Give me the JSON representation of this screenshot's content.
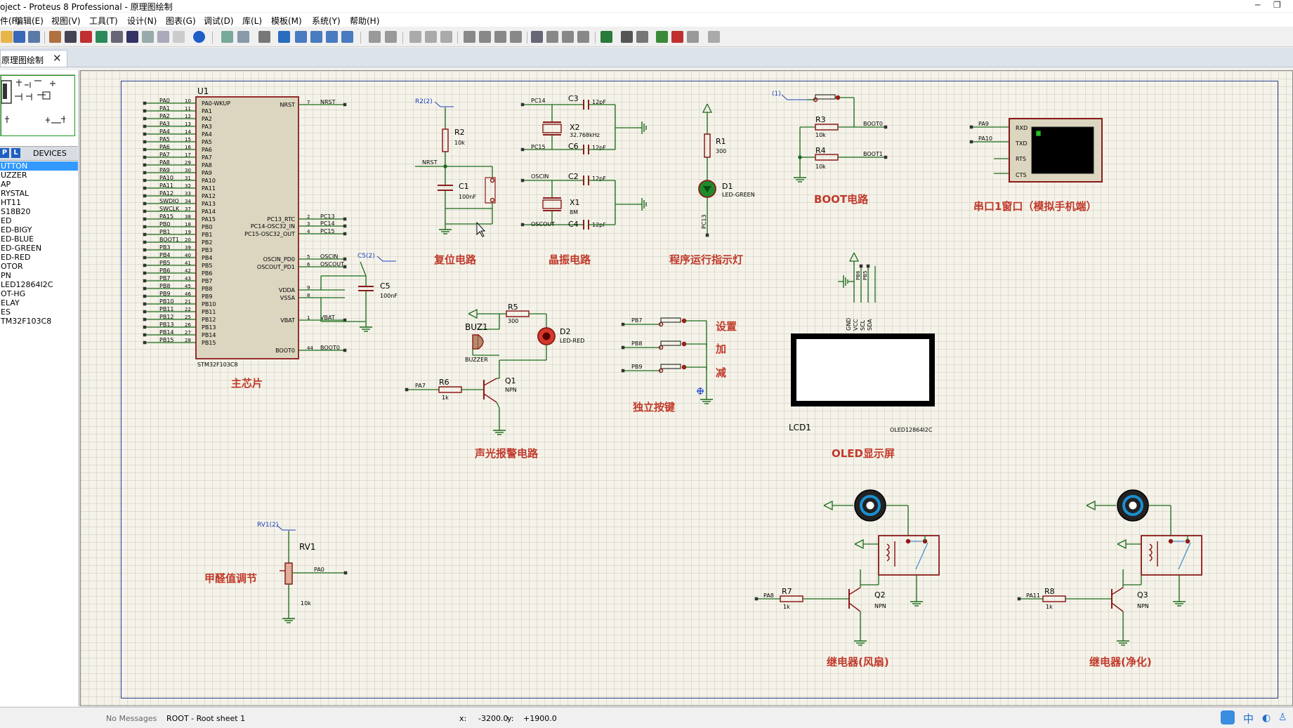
{
  "window": {
    "title": "oject - Proteus 8 Professional - 原理图绘制",
    "minimize": "─",
    "restore": "❐"
  },
  "menu": [
    "件(F)",
    "编辑(E)",
    "视图(V)",
    "工具(T)",
    "设计(N)",
    "图表(G)",
    "调试(D)",
    "库(L)",
    "模板(M)",
    "系统(Y)",
    "帮助(H)"
  ],
  "tab": {
    "label": "原理图绘制",
    "close": "✕"
  },
  "panel": {
    "p_button": "P",
    "l_button": "L",
    "header": "DEVICES",
    "devices": [
      "UTTON",
      "UZZER",
      "AP",
      "RYSTAL",
      "HT11",
      "S18B20",
      "ED",
      "ED-BIGY",
      "ED-BLUE",
      "ED-GREEN",
      "ED-RED",
      "OTOR",
      "PN",
      "LED12864I2C",
      "OT-HG",
      "ELAY",
      "ES",
      "TM32F103C8"
    ],
    "selected_index": 0
  },
  "schematic": {
    "labels": {
      "main_chip": "主芯片",
      "reset": "复位电路",
      "crystal": "晶振电路",
      "run_led": "程序运行指示灯",
      "boot": "BOOT电路",
      "uart": "串口1窗口（模拟手机端）",
      "alarm": "声光报警电路",
      "keys": "独立按键",
      "oled": "OLED显示屏",
      "formaldehyde": "甲醛值调节",
      "relay_fan": "继电器(风扇)",
      "relay_purify": "继电器(净化)",
      "set": "设置",
      "add": "加",
      "sub": "减"
    },
    "u1": {
      "ref": "U1",
      "part": "STM32F103C8",
      "left_pins": [
        {
          "net": "PA0",
          "num": "10",
          "name": "PA0-WKUP"
        },
        {
          "net": "PA1",
          "num": "11",
          "name": "PA1"
        },
        {
          "net": "PA2",
          "num": "12",
          "name": "PA2"
        },
        {
          "net": "PA3",
          "num": "13",
          "name": "PA3"
        },
        {
          "net": "PA4",
          "num": "14",
          "name": "PA4"
        },
        {
          "net": "PA5",
          "num": "15",
          "name": "PA5"
        },
        {
          "net": "PA6",
          "num": "16",
          "name": "PA6"
        },
        {
          "net": "PA7",
          "num": "17",
          "name": "PA7"
        },
        {
          "net": "PA8",
          "num": "29",
          "name": "PA8"
        },
        {
          "net": "PA9",
          "num": "30",
          "name": "PA9"
        },
        {
          "net": "PA10",
          "num": "31",
          "name": "PA10"
        },
        {
          "net": "PA11",
          "num": "32",
          "name": "PA11"
        },
        {
          "net": "PA12",
          "num": "33",
          "name": "PA12"
        },
        {
          "net": "SWDIO",
          "num": "34",
          "name": "PA13"
        },
        {
          "net": "SWCLK",
          "num": "37",
          "name": "PA14"
        },
        {
          "net": "PA15",
          "num": "38",
          "name": "PA15"
        },
        {
          "net": "PB0",
          "num": "18",
          "name": "PB0"
        },
        {
          "net": "PB1",
          "num": "19",
          "name": "PB1"
        },
        {
          "net": "BOOT1",
          "num": "20",
          "name": "PB2"
        },
        {
          "net": "PB3",
          "num": "39",
          "name": "PB3"
        },
        {
          "net": "PB4",
          "num": "40",
          "name": "PB4"
        },
        {
          "net": "PB5",
          "num": "41",
          "name": "PB5"
        },
        {
          "net": "PB6",
          "num": "42",
          "name": "PB6"
        },
        {
          "net": "PB7",
          "num": "43",
          "name": "PB7"
        },
        {
          "net": "PB8",
          "num": "45",
          "name": "PB8"
        },
        {
          "net": "PB9",
          "num": "46",
          "name": "PB9"
        },
        {
          "net": "PB10",
          "num": "21",
          "name": "PB10"
        },
        {
          "net": "PB11",
          "num": "22",
          "name": "PB11"
        },
        {
          "net": "PB12",
          "num": "25",
          "name": "PB12"
        },
        {
          "net": "PB13",
          "num": "26",
          "name": "PB13"
        },
        {
          "net": "PB14",
          "num": "27",
          "name": "PB14"
        },
        {
          "net": "PB15",
          "num": "28",
          "name": "PB15"
        }
      ],
      "right_pins": [
        {
          "name": "NRST",
          "num": "7",
          "net": "NRST"
        },
        {
          "name": "PC13_RTC",
          "num": "2",
          "net": "PC13"
        },
        {
          "name": "PC14-OSC32_IN",
          "num": "3",
          "net": "PC14"
        },
        {
          "name": "PC15-OSC32_OUT",
          "num": "4",
          "net": "PC15"
        },
        {
          "name": "OSCIN_PD0",
          "num": "5",
          "net": "OSCIN"
        },
        {
          "name": "OSCOUT_PD1",
          "num": "6",
          "net": "OSCOUT"
        },
        {
          "name": "VDDA",
          "num": "9",
          "net": ""
        },
        {
          "name": "VSSA",
          "num": "8",
          "net": ""
        },
        {
          "name": "VBAT",
          "num": "1",
          "net": "VBAT"
        },
        {
          "name": "BOOT0",
          "num": "44",
          "net": "BOOT0"
        }
      ]
    },
    "parts": {
      "r2": "R2",
      "r2v": "10k",
      "r2probe": "R2(2)",
      "c1": "C1",
      "c1v": "100nF",
      "nrst": "NRST",
      "c3": "C3",
      "c3v": "12pF",
      "x2": "X2",
      "x2v": "32.768kHz",
      "c6": "C6",
      "c6v": "12pF",
      "pc14": "PC14",
      "pc15": "PC15",
      "c2": "C2",
      "c2v": "12pF",
      "x1": "X1",
      "x1v": "8M",
      "c4": "C4",
      "c4v": "12pF",
      "oscin": "OSCIN",
      "oscout": "OSCOUT",
      "r1": "R1",
      "r1v": "300",
      "d1": "D1",
      "d1v": "LED-GREEN",
      "pc13": "PC13",
      "probe1": "(1)",
      "r3": "R3",
      "r3v": "10k",
      "r4": "R4",
      "r4v": "10k",
      "boot0": "BOOT0",
      "boot1": "BOOT1",
      "pa9": "PA9",
      "pa10": "PA10",
      "rxd": "RXD",
      "txd": "TXD",
      "rts": "RTS",
      "cts": "CTS",
      "c5": "C5",
      "c5v": "100nF",
      "c5probe": "C5(2)",
      "r5": "R5",
      "r5v": "300",
      "d2": "D2",
      "d2v": "LED-RED",
      "buz": "BUZ1",
      "buzv": "BUZZER",
      "r6": "R6",
      "r6v": "1k",
      "pa7": "PA7",
      "q1": "Q1",
      "q1v": "NPN",
      "pb7": "PB7",
      "pb8": "PB8",
      "pb9": "PB9",
      "gnd": "GND",
      "vcc": "VCC",
      "scl": "SCL",
      "sda": "SDA",
      "pb6": "PB6",
      "pb5": "PB5",
      "lcd1": "LCD1",
      "oledpart": "OLED12864I2C",
      "rv1probe": "RV1(2)",
      "rv1": "RV1",
      "rv1v": "10k",
      "pa0": "PA0",
      "pa8": "PA8",
      "r7": "R7",
      "r7v": "1k",
      "q2": "Q2",
      "q2v": "NPN",
      "pa11": "PA11",
      "r8": "R8",
      "r8v": "1k",
      "q3": "Q3",
      "q3v": "NPN"
    }
  },
  "status": {
    "messages": "No Messages",
    "sheet": "ROOT - Root sheet 1",
    "x_label": "x:",
    "x_value": "-3200.0",
    "y_label": "y:",
    "y_value": "+1900.0",
    "ime_char": "中"
  },
  "colors": {
    "wire": "#1a6b1a",
    "component": "#8b1a1a",
    "title": "#c0392b",
    "canvas": "#f5f3e9",
    "sheet_border": "#2a3b8f",
    "probe": "#2040c0"
  }
}
